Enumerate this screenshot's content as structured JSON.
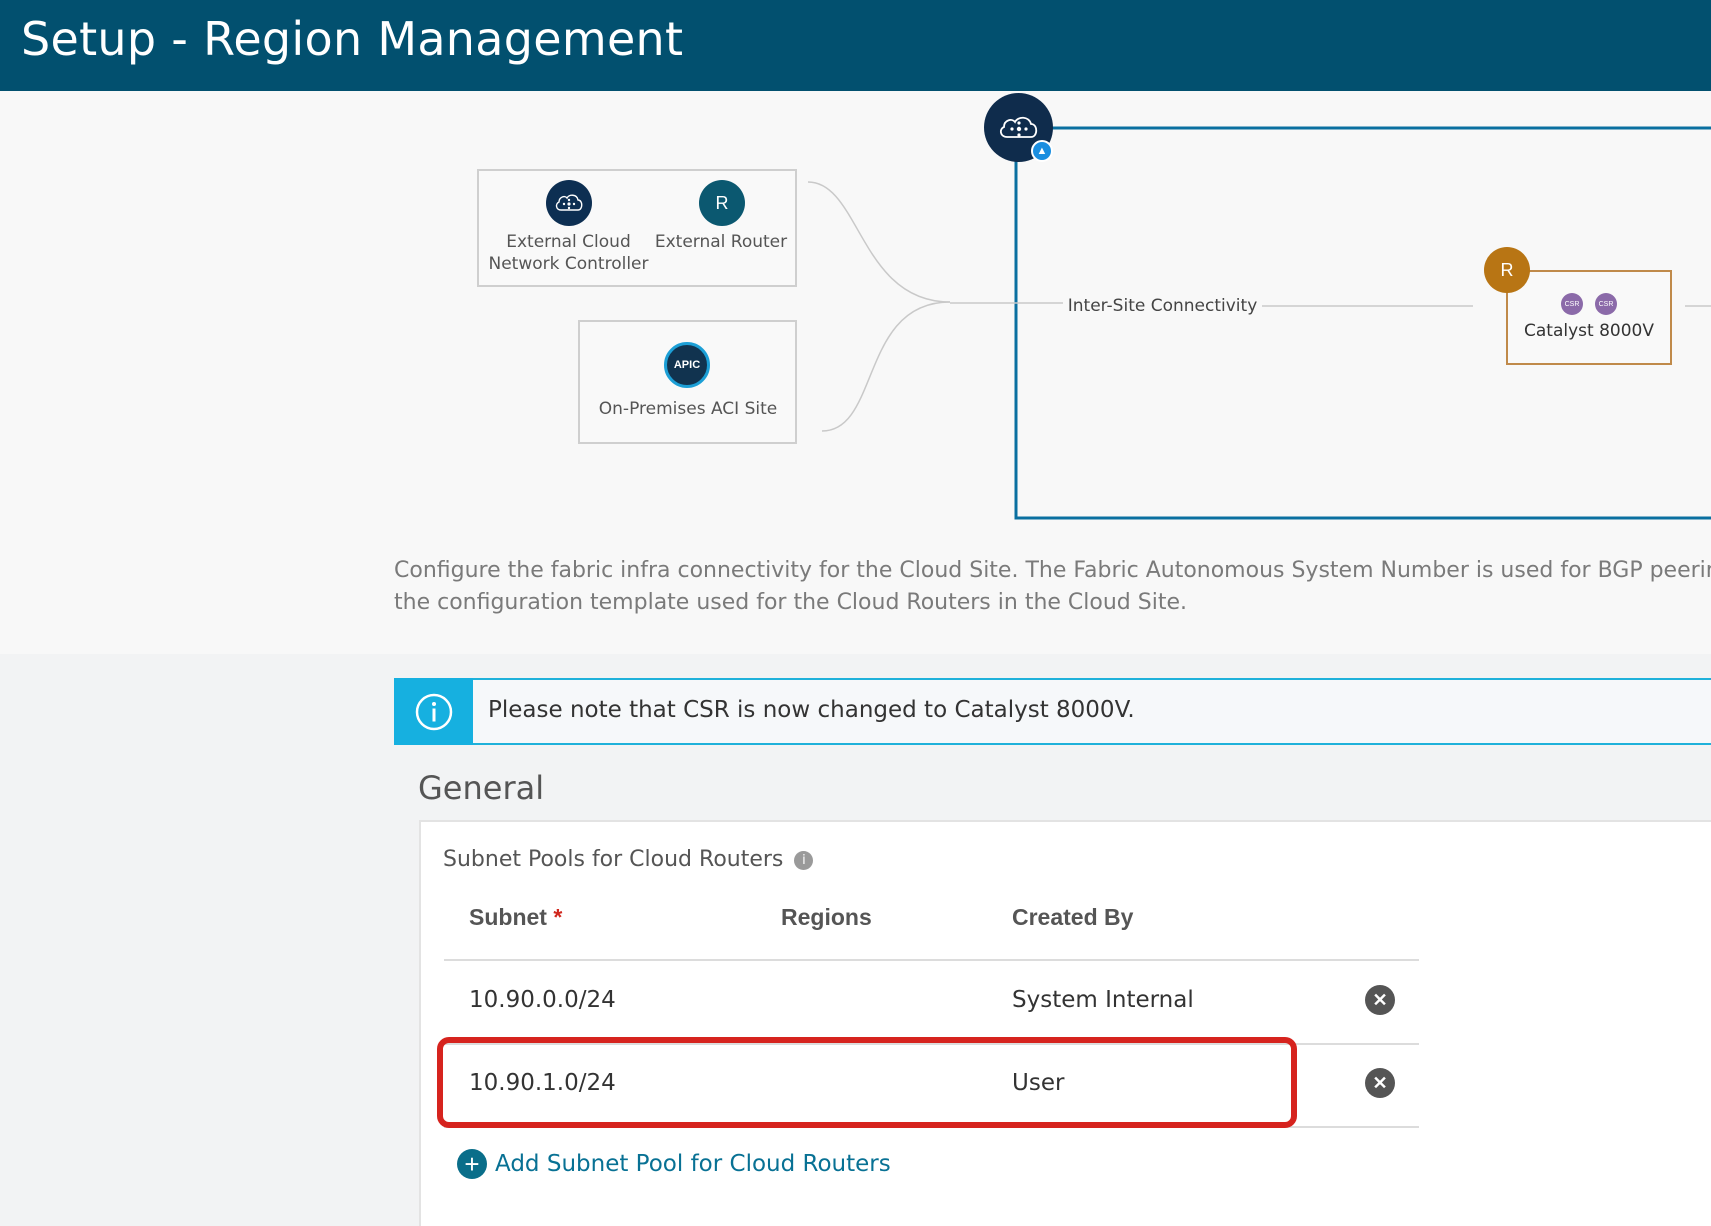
{
  "header": {
    "title": "Setup - Region Management"
  },
  "topology": {
    "external_cloud_label": "External Cloud Network Controller",
    "external_cloud_line1": "External Cloud",
    "external_cloud_line2": "Network Controller",
    "external_router_letter": "R",
    "external_router_label": "External Router",
    "onprem_badge": "APIC",
    "onprem_label": "On-Premises ACI Site",
    "inter_site_label": "Inter-Site Connectivity",
    "router_letter": "R",
    "csr_badge_1": "CSR",
    "csr_badge_2": "CSR",
    "catalyst_label": "Catalyst 8000V"
  },
  "description": {
    "line1": "Configure the fabric infra connectivity for the Cloud Site. The Fabric Autonomous System Number is used for BGP peering insic",
    "line2": "the configuration template used for the Cloud Routers in the Cloud Site."
  },
  "banner": {
    "text": "Please note that CSR is now changed to Catalyst 8000V."
  },
  "general": {
    "title": "General",
    "subnet_pools_label": "Subnet Pools for Cloud Routers",
    "columns": {
      "subnet": "Subnet",
      "required_mark": "*",
      "regions": "Regions",
      "created_by": "Created By"
    },
    "rows": [
      {
        "subnet": "10.90.0.0/24",
        "regions": "",
        "created_by": "System Internal"
      },
      {
        "subnet": "10.90.1.0/24",
        "regions": "",
        "created_by": "User"
      }
    ],
    "add_label": "Add Subnet Pool for Cloud Routers"
  },
  "colors": {
    "header_bg": "#02506f",
    "info_accent": "#16b0e0",
    "highlight": "#d6231e",
    "router_orange": "#b87514",
    "link": "#087194"
  },
  "icons": {
    "cloud_site": "cloud-network-icon",
    "azure_badge": "azure-icon",
    "info": "info-icon",
    "remove": "close-circle-icon",
    "add": "plus-circle-icon"
  }
}
